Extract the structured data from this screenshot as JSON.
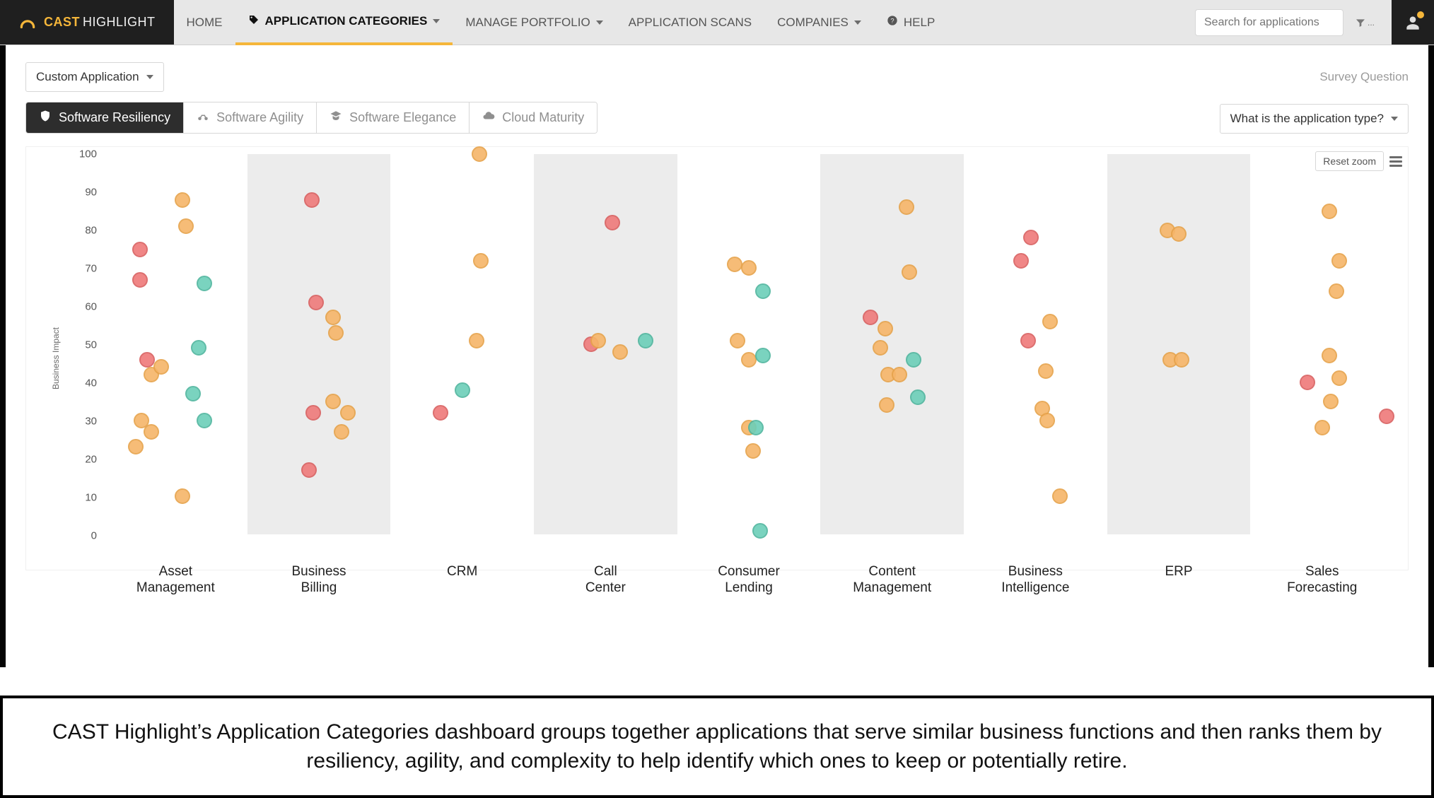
{
  "brand": {
    "cast": "CAST",
    "highlight": "HIGHLIGHT"
  },
  "nav": {
    "items": [
      {
        "label": "HOME",
        "dropdown": false,
        "active": false,
        "icon": null
      },
      {
        "label": "APPLICATION CATEGORIES",
        "dropdown": true,
        "active": true,
        "icon": "tag-icon"
      },
      {
        "label": "MANAGE PORTFOLIO",
        "dropdown": true,
        "active": false,
        "icon": null
      },
      {
        "label": "APPLICATION SCANS",
        "dropdown": false,
        "active": false,
        "icon": null
      },
      {
        "label": "COMPANIES",
        "dropdown": true,
        "active": false,
        "icon": null
      },
      {
        "label": "HELP",
        "dropdown": false,
        "active": false,
        "icon": "help-icon"
      }
    ],
    "search_placeholder": "Search for applications",
    "filter_glyph": "▼ ..."
  },
  "controls": {
    "app_dropdown": "Custom Application",
    "survey_label": "Survey Question",
    "question_dropdown": "What is the application type?",
    "tabs": [
      {
        "label": "Software Resiliency",
        "active": true,
        "icon": "shield-icon"
      },
      {
        "label": "Software Agility",
        "active": false,
        "icon": "motorcycle-icon"
      },
      {
        "label": "Software Elegance",
        "active": false,
        "icon": "graduation-icon"
      },
      {
        "label": "Cloud Maturity",
        "active": false,
        "icon": "cloud-icon"
      }
    ],
    "reset_zoom": "Reset zoom"
  },
  "caption": "CAST Highlight’s Application Categories dashboard groups together applications that serve similar business functions and then ranks them by resiliency, agility, and complexity to help identify which ones to keep or potentially retire.",
  "chart_data": {
    "type": "scatter",
    "title": "",
    "xlabel": "",
    "ylabel": "Business Impact",
    "ylim": [
      0,
      100
    ],
    "yticks": [
      0,
      10,
      20,
      30,
      40,
      50,
      60,
      70,
      80,
      90,
      100
    ],
    "categories": [
      "Asset Management",
      "Business Billing",
      "CRM",
      "Call Center",
      "Consumer Lending",
      "Content Management",
      "Business Intelligence",
      "ERP",
      "Sales Forecasting"
    ],
    "series_colors": {
      "red": "#ef7a7a",
      "orange": "#f6b569",
      "teal": "#6ccfb9"
    },
    "points": [
      {
        "cat": 0,
        "xoff": 0.25,
        "y": 75,
        "c": "red"
      },
      {
        "cat": 0,
        "xoff": 0.25,
        "y": 67,
        "c": "red"
      },
      {
        "cat": 0,
        "xoff": 0.3,
        "y": 46,
        "c": "red"
      },
      {
        "cat": 0,
        "xoff": 0.33,
        "y": 42,
        "c": "orange"
      },
      {
        "cat": 0,
        "xoff": 0.4,
        "y": 44,
        "c": "orange"
      },
      {
        "cat": 0,
        "xoff": 0.26,
        "y": 30,
        "c": "orange"
      },
      {
        "cat": 0,
        "xoff": 0.22,
        "y": 23,
        "c": "orange"
      },
      {
        "cat": 0,
        "xoff": 0.33,
        "y": 27,
        "c": "orange"
      },
      {
        "cat": 0,
        "xoff": 0.55,
        "y": 88,
        "c": "orange"
      },
      {
        "cat": 0,
        "xoff": 0.57,
        "y": 81,
        "c": "orange"
      },
      {
        "cat": 0,
        "xoff": 0.55,
        "y": 10,
        "c": "orange"
      },
      {
        "cat": 0,
        "xoff": 0.7,
        "y": 66,
        "c": "teal"
      },
      {
        "cat": 0,
        "xoff": 0.66,
        "y": 49,
        "c": "teal"
      },
      {
        "cat": 0,
        "xoff": 0.62,
        "y": 37,
        "c": "teal"
      },
      {
        "cat": 0,
        "xoff": 0.7,
        "y": 30,
        "c": "teal"
      },
      {
        "cat": 1,
        "xoff": 0.45,
        "y": 88,
        "c": "red"
      },
      {
        "cat": 1,
        "xoff": 0.48,
        "y": 61,
        "c": "red"
      },
      {
        "cat": 1,
        "xoff": 0.46,
        "y": 32,
        "c": "red"
      },
      {
        "cat": 1,
        "xoff": 0.43,
        "y": 17,
        "c": "red"
      },
      {
        "cat": 1,
        "xoff": 0.6,
        "y": 57,
        "c": "orange"
      },
      {
        "cat": 1,
        "xoff": 0.62,
        "y": 53,
        "c": "orange"
      },
      {
        "cat": 1,
        "xoff": 0.6,
        "y": 35,
        "c": "orange"
      },
      {
        "cat": 1,
        "xoff": 0.7,
        "y": 32,
        "c": "orange"
      },
      {
        "cat": 1,
        "xoff": 0.66,
        "y": 27,
        "c": "orange"
      },
      {
        "cat": 2,
        "xoff": 0.35,
        "y": 32,
        "c": "red"
      },
      {
        "cat": 2,
        "xoff": 0.62,
        "y": 100,
        "c": "orange"
      },
      {
        "cat": 2,
        "xoff": 0.63,
        "y": 72,
        "c": "orange"
      },
      {
        "cat": 2,
        "xoff": 0.6,
        "y": 51,
        "c": "orange"
      },
      {
        "cat": 2,
        "xoff": 0.5,
        "y": 38,
        "c": "teal"
      },
      {
        "cat": 3,
        "xoff": 0.4,
        "y": 50,
        "c": "red"
      },
      {
        "cat": 3,
        "xoff": 0.45,
        "y": 51,
        "c": "orange"
      },
      {
        "cat": 3,
        "xoff": 0.55,
        "y": 82,
        "c": "red"
      },
      {
        "cat": 3,
        "xoff": 0.6,
        "y": 48,
        "c": "orange"
      },
      {
        "cat": 3,
        "xoff": 0.78,
        "y": 51,
        "c": "teal"
      },
      {
        "cat": 4,
        "xoff": 0.4,
        "y": 71,
        "c": "orange"
      },
      {
        "cat": 4,
        "xoff": 0.5,
        "y": 70,
        "c": "orange"
      },
      {
        "cat": 4,
        "xoff": 0.42,
        "y": 51,
        "c": "orange"
      },
      {
        "cat": 4,
        "xoff": 0.5,
        "y": 46,
        "c": "orange"
      },
      {
        "cat": 4,
        "xoff": 0.6,
        "y": 47,
        "c": "teal"
      },
      {
        "cat": 4,
        "xoff": 0.6,
        "y": 64,
        "c": "teal"
      },
      {
        "cat": 4,
        "xoff": 0.5,
        "y": 28,
        "c": "orange"
      },
      {
        "cat": 4,
        "xoff": 0.55,
        "y": 28,
        "c": "teal"
      },
      {
        "cat": 4,
        "xoff": 0.53,
        "y": 22,
        "c": "orange"
      },
      {
        "cat": 4,
        "xoff": 0.58,
        "y": 1,
        "c": "teal"
      },
      {
        "cat": 5,
        "xoff": 0.35,
        "y": 57,
        "c": "red"
      },
      {
        "cat": 5,
        "xoff": 0.45,
        "y": 54,
        "c": "orange"
      },
      {
        "cat": 5,
        "xoff": 0.42,
        "y": 49,
        "c": "orange"
      },
      {
        "cat": 5,
        "xoff": 0.47,
        "y": 42,
        "c": "orange"
      },
      {
        "cat": 5,
        "xoff": 0.55,
        "y": 42,
        "c": "orange"
      },
      {
        "cat": 5,
        "xoff": 0.46,
        "y": 34,
        "c": "orange"
      },
      {
        "cat": 5,
        "xoff": 0.6,
        "y": 86,
        "c": "orange"
      },
      {
        "cat": 5,
        "xoff": 0.62,
        "y": 69,
        "c": "orange"
      },
      {
        "cat": 5,
        "xoff": 0.65,
        "y": 46,
        "c": "teal"
      },
      {
        "cat": 5,
        "xoff": 0.68,
        "y": 36,
        "c": "teal"
      },
      {
        "cat": 6,
        "xoff": 0.47,
        "y": 78,
        "c": "red"
      },
      {
        "cat": 6,
        "xoff": 0.4,
        "y": 72,
        "c": "red"
      },
      {
        "cat": 6,
        "xoff": 0.45,
        "y": 51,
        "c": "red"
      },
      {
        "cat": 6,
        "xoff": 0.6,
        "y": 56,
        "c": "orange"
      },
      {
        "cat": 6,
        "xoff": 0.57,
        "y": 43,
        "c": "orange"
      },
      {
        "cat": 6,
        "xoff": 0.55,
        "y": 33,
        "c": "orange"
      },
      {
        "cat": 6,
        "xoff": 0.58,
        "y": 30,
        "c": "orange"
      },
      {
        "cat": 6,
        "xoff": 0.67,
        "y": 10,
        "c": "orange"
      },
      {
        "cat": 7,
        "xoff": 0.42,
        "y": 80,
        "c": "orange"
      },
      {
        "cat": 7,
        "xoff": 0.5,
        "y": 79,
        "c": "orange"
      },
      {
        "cat": 7,
        "xoff": 0.44,
        "y": 46,
        "c": "orange"
      },
      {
        "cat": 7,
        "xoff": 0.52,
        "y": 46,
        "c": "orange"
      },
      {
        "cat": 8,
        "xoff": 0.55,
        "y": 85,
        "c": "orange"
      },
      {
        "cat": 8,
        "xoff": 0.62,
        "y": 72,
        "c": "orange"
      },
      {
        "cat": 8,
        "xoff": 0.6,
        "y": 64,
        "c": "orange"
      },
      {
        "cat": 8,
        "xoff": 0.55,
        "y": 47,
        "c": "orange"
      },
      {
        "cat": 8,
        "xoff": 0.62,
        "y": 41,
        "c": "orange"
      },
      {
        "cat": 8,
        "xoff": 0.56,
        "y": 35,
        "c": "orange"
      },
      {
        "cat": 8,
        "xoff": 0.5,
        "y": 28,
        "c": "orange"
      },
      {
        "cat": 8,
        "xoff": 0.4,
        "y": 40,
        "c": "red"
      },
      {
        "cat": 8,
        "xoff": 0.95,
        "y": 31,
        "c": "red"
      }
    ]
  }
}
